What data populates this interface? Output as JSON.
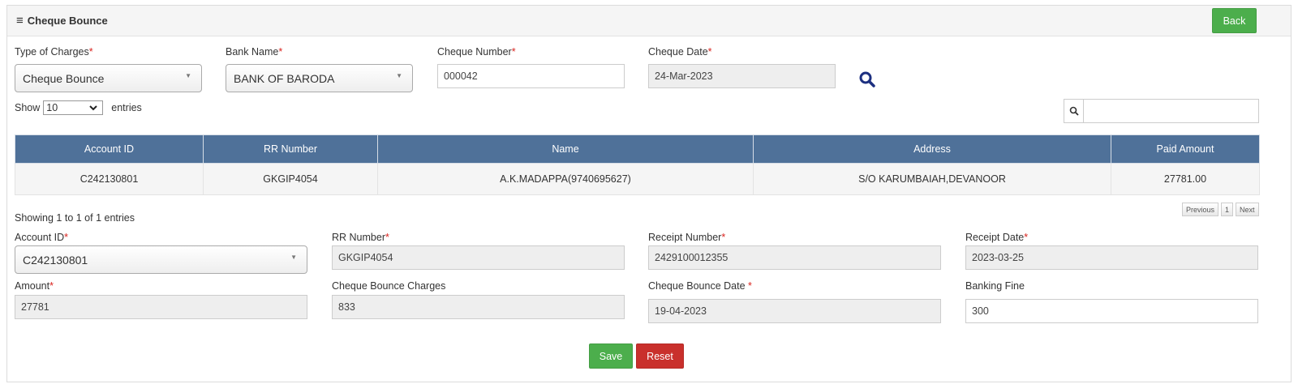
{
  "header": {
    "title": "Cheque Bounce",
    "back_label": "Back"
  },
  "filters": {
    "type_of_charges": {
      "label": "Type of Charges",
      "value": "Cheque Bounce"
    },
    "bank_name": {
      "label": "Bank Name",
      "value": "BANK OF BARODA"
    },
    "cheque_number": {
      "label": "Cheque Number",
      "value": "000042"
    },
    "cheque_date": {
      "label": "Cheque Date",
      "value": "24-Mar-2023"
    }
  },
  "required_mark": "*",
  "entries": {
    "show_label": "Show",
    "value": "10",
    "entries_label": "entries"
  },
  "table": {
    "columns": [
      "Account ID",
      "RR Number",
      "Name",
      "Address",
      "Paid Amount"
    ],
    "rows": [
      [
        "C242130801",
        "GKGIP4054",
        "A.K.MADAPPA(9740695627)",
        "S/O KARUMBAIAH,DEVANOOR",
        "27781.00"
      ]
    ]
  },
  "showing_text": "Showing 1 to 1 of 1 entries",
  "pagination": {
    "previous": "Previous",
    "page": "1",
    "next": "Next"
  },
  "form": {
    "account_id": {
      "label": "Account ID",
      "value": "C242130801"
    },
    "rr_number": {
      "label": "RR Number",
      "value": "GKGIP4054"
    },
    "receipt_number": {
      "label": "Receipt Number",
      "value": "2429100012355"
    },
    "receipt_date": {
      "label": "Receipt Date",
      "value": "2023-03-25"
    },
    "amount": {
      "label": "Amount",
      "value": "27781"
    },
    "cheque_bounce_charges": {
      "label": "Cheque Bounce Charges",
      "value": "833"
    },
    "cheque_bounce_date": {
      "label": "Cheque Bounce Date ",
      "value": "19-04-2023"
    },
    "banking_fine": {
      "label": "Banking Fine",
      "value": "300"
    }
  },
  "actions": {
    "save_label": "Save",
    "reset_label": "Reset"
  },
  "colors": {
    "table_header": "#4f7199",
    "save": "#4cae4c",
    "reset": "#c9302c",
    "search_icon": "#1c2f80",
    "required": "#d9231e"
  },
  "icons": {
    "menu": "hamburger-icon",
    "search": "search-icon",
    "table_search": "search-icon",
    "dropdown": "caret-down-icon"
  }
}
